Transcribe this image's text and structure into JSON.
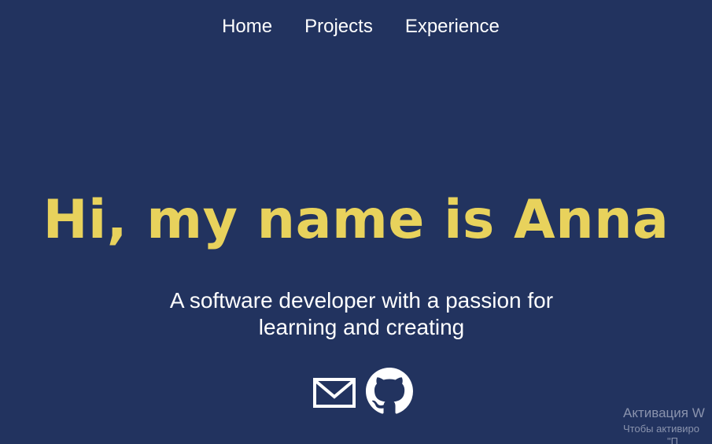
{
  "nav": {
    "items": [
      {
        "label": "Home"
      },
      {
        "label": "Projects"
      },
      {
        "label": "Experience"
      }
    ]
  },
  "hero": {
    "title": "Hi, my name is Anna",
    "subtitle_line1": "A software developer with a passion for",
    "subtitle_line2": "learning and creating"
  },
  "socials": {
    "icons": [
      "envelope-icon",
      "github-icon"
    ]
  },
  "watermark": {
    "title": "Активация W",
    "line1": "Чтобы активиро",
    "line2": "\"П"
  },
  "colors": {
    "background": "#22335f",
    "accent": "#e8d25c",
    "text": "#ffffff"
  }
}
